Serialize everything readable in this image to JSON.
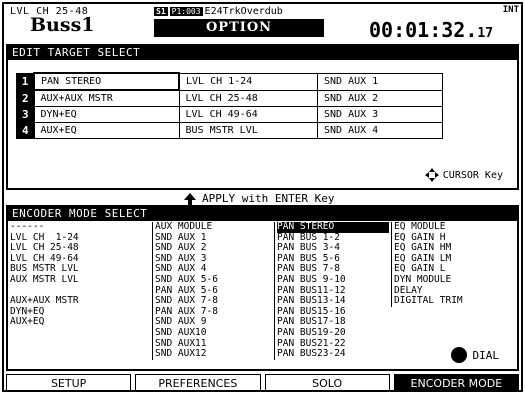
{
  "header": {
    "channel_label": "LVL CH 25-48",
    "bus_name": "Buss1",
    "scene_badge": "S1",
    "scene_number": "P1:003",
    "project_name": "E24TrkOverdub",
    "screen_title": "OPTION",
    "sync_label": "INT",
    "time_main": "00:01:32.",
    "time_frac": "17"
  },
  "edit_target": {
    "title": "EDIT TARGET SELECT",
    "rows": [
      {
        "num": "1",
        "c1": "PAN STEREO",
        "c2": "LVL CH  1-24",
        "c3": "SND AUX 1"
      },
      {
        "num": "2",
        "c1": "AUX+AUX MSTR",
        "c2": "LVL CH 25-48",
        "c3": "SND AUX 2"
      },
      {
        "num": "3",
        "c1": "DYN+EQ",
        "c2": "LVL CH 49-64",
        "c3": "SND AUX 3"
      },
      {
        "num": "4",
        "c1": "AUX+EQ",
        "c2": "BUS MSTR LVL",
        "c3": "SND AUX 4"
      }
    ],
    "cursor_hint": "CURSOR Key",
    "apply_hint": "APPLY with ENTER Key"
  },
  "encoder_mode": {
    "title": "ENCODER MODE SELECT",
    "col1": [
      "------",
      "LVL CH  1-24",
      "LVL CH 25-48",
      "LVL CH 49-64",
      "BUS MSTR LVL",
      "AUX MSTR LVL",
      "",
      "AUX+AUX MSTR",
      "DYN+EQ",
      "AUX+EQ",
      "",
      "",
      ""
    ],
    "col2": [
      "AUX MODULE",
      "SND AUX 1",
      "SND AUX 2",
      "SND AUX 3",
      "SND AUX 4",
      "SND AUX 5-6",
      "PAN AUX 5-6",
      "SND AUX 7-8",
      "PAN AUX 7-8",
      "SND AUX 9",
      "SND AUX10",
      "SND AUX11",
      "SND AUX12"
    ],
    "col3": [
      "PAN STEREO",
      "PAN BUS 1-2",
      "PAN BUS 3-4",
      "PAN BUS 5-6",
      "PAN BUS 7-8",
      "PAN BUS 9-10",
      "PAN BUS11-12",
      "PAN BUS13-14",
      "PAN BUS15-16",
      "PAN BUS17-18",
      "PAN BUS19-20",
      "PAN BUS21-22",
      "PAN BUS23-24"
    ],
    "col4": [
      "EQ MODULE",
      "EQ GAIN H",
      "EQ GAIN HM",
      "EQ GAIN LM",
      "EQ GAIN L",
      "DYN MODULE",
      "DELAY",
      "DIGITAL TRIM"
    ],
    "selected_col3": "PAN STEREO",
    "dial_hint": "DIAL"
  },
  "tabs": [
    {
      "label": "SETUP",
      "active": false
    },
    {
      "label": "PREFERENCES",
      "active": false
    },
    {
      "label": "SOLO",
      "active": false
    },
    {
      "label": "ENCODER MODE",
      "active": true
    }
  ]
}
